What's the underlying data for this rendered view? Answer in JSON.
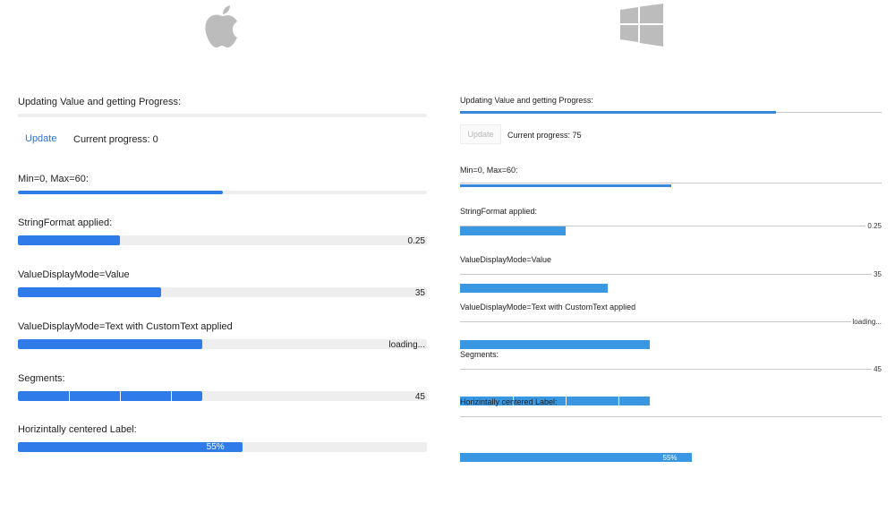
{
  "colors": {
    "mac_accent": "#2f7bea",
    "mac_track": "#eeeeee",
    "win_accent": "#3a98e3",
    "win_track": "#c6c6c6",
    "logo_gray": "#bcbcbc"
  },
  "icons": {
    "mac_logo": "apple-icon",
    "win_logo": "windows-icon"
  },
  "mac": {
    "updating": {
      "label": "Updating Value and getting Progress:",
      "progress": 0
    },
    "update_button": "Update",
    "current_progress": "Current progress: 0",
    "minmax": {
      "label": "Min=0, Max=60:",
      "progress": 0.5
    },
    "stringformat": {
      "label": "StringFormat applied:",
      "progress": 0.25,
      "value": "0.25"
    },
    "displayvalue": {
      "label": "ValueDisplayMode=Value",
      "progress": 0.35,
      "value": "35"
    },
    "customtext": {
      "label": "ValueDisplayMode=Text with CustomText applied",
      "progress": 0.45,
      "value": "loading..."
    },
    "segments": {
      "label": "Segments:",
      "progress": 0.45,
      "value": "45",
      "count": 8
    },
    "centered": {
      "label": "Horizintally centered Label:",
      "progress": 0.55,
      "value": "55%"
    }
  },
  "win": {
    "updating": {
      "label": "Updating Value and getting Progress:",
      "progress": 0.75
    },
    "update_button": "Update",
    "current_progress": "Current progress: 75",
    "minmax": {
      "label": "Min=0, Max=60:",
      "progress": 0.5
    },
    "stringformat": {
      "label": "StringFormat applied:",
      "progress": 0.25,
      "value": "0.25"
    },
    "displayvalue": {
      "label": "ValueDisplayMode=Value",
      "progress": 0.35,
      "value": "35"
    },
    "customtext": {
      "label": "ValueDisplayMode=Text with CustomText applied",
      "progress": 0.45,
      "value": "loading..."
    },
    "segments": {
      "label": "Segments:",
      "progress": 0.45,
      "value": "45",
      "count": 8
    },
    "centered": {
      "label": "Horizintally centered Label:",
      "progress": 0.55,
      "value": "55%"
    }
  }
}
